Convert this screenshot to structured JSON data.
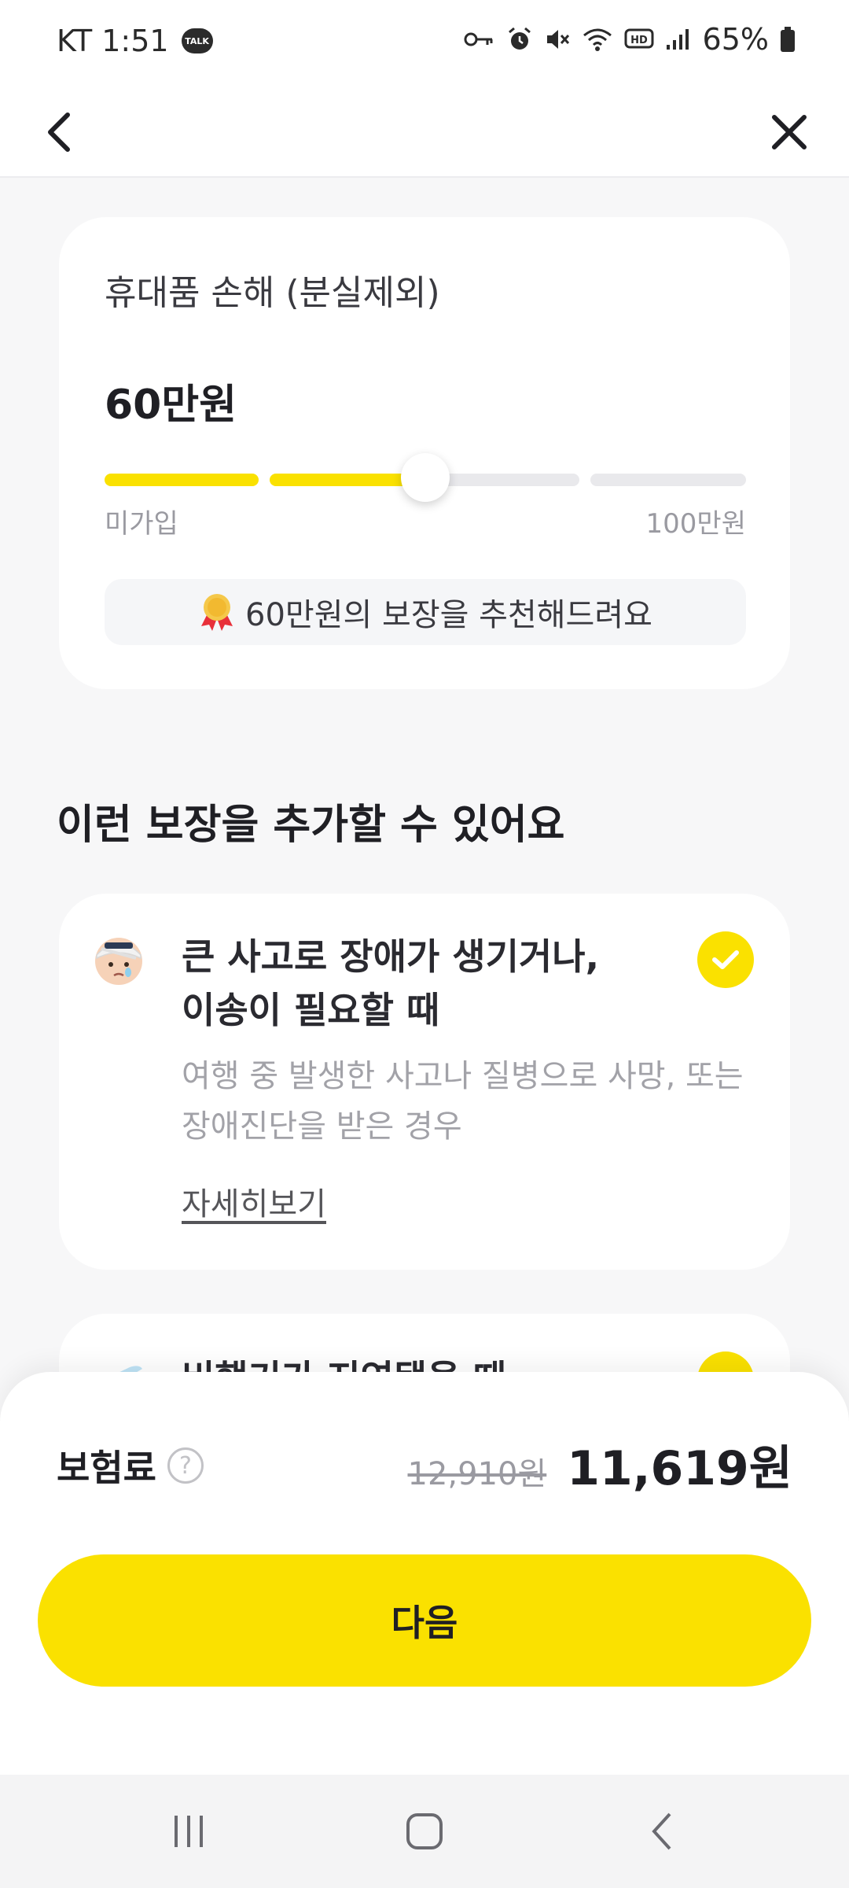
{
  "status_bar": {
    "carrier_time": "KT 1:51",
    "talk_badge": "TALK",
    "battery": "65%"
  },
  "header": {
    "back_icon": "back-arrow-icon",
    "close_icon": "close-icon"
  },
  "coverage": {
    "title": "휴대품 손해 (분실제외)",
    "amount": "60만원",
    "slider_min": "미가입",
    "slider_max": "100만원",
    "slider_value_fraction": 0.5,
    "recommendation": "60만원의 보장을 추천해드려요"
  },
  "section": {
    "heading": "이런 보장을 추가할 수 있어요"
  },
  "addon": {
    "title": "큰 사고로 장애가 생기거나,\n이송이 필요할 때",
    "description": "여행 중 발생한 사고나 질병으로 사망, 또는 장애진단을 받은 경우",
    "detail_link": "자세히보기",
    "checked": true
  },
  "addon_2": {
    "title": "비행기가 지연됐을 때"
  },
  "bottom": {
    "premium_label": "보험료",
    "help_symbol": "?",
    "original_price": "12,910원",
    "discount_price": "11,619원",
    "next_button": "다음"
  },
  "colors": {
    "accent": "#fae100",
    "text_primary": "#1f1f24",
    "text_secondary": "#9a9aa1",
    "background": "#f7f7f8"
  }
}
